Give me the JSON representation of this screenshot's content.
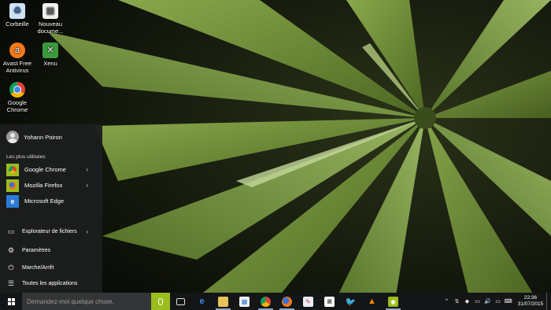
{
  "desktop": {
    "icons": [
      {
        "label": "Corbeille",
        "icon": "recycle-bin-icon"
      },
      {
        "label": "Nouveau docume...",
        "icon": "document-icon"
      },
      {
        "label": "Avast Free Antivirus",
        "icon": "avast-icon"
      },
      {
        "label": "Xenu",
        "icon": "xenu-icon"
      },
      {
        "label": "Google Chrome",
        "icon": "chrome-icon"
      }
    ]
  },
  "start_menu": {
    "user_name": "Yohann Poiron",
    "most_used_label": "Les plus utilisées",
    "apps": [
      {
        "label": "Google Chrome",
        "icon": "chrome-icon",
        "has_submenu": true
      },
      {
        "label": "Mozilla Firefox",
        "icon": "firefox-icon",
        "has_submenu": true
      },
      {
        "label": "Microsoft Edge",
        "icon": "edge-icon",
        "has_submenu": false
      }
    ],
    "system_items": [
      {
        "label": "Explorateur de fichiers",
        "icon": "folder-icon",
        "has_submenu": true
      },
      {
        "label": "Paramètres",
        "icon": "gear-icon"
      },
      {
        "label": "Marche/Arrêt",
        "icon": "power-icon"
      },
      {
        "label": "Toutes les applications",
        "icon": "apps-list-icon"
      }
    ]
  },
  "taskbar": {
    "search_placeholder": "Demandez-moi quelque chose.",
    "clock_time": "22:36",
    "clock_date": "31/07/2015",
    "accent_color": "#9bbd1e"
  }
}
